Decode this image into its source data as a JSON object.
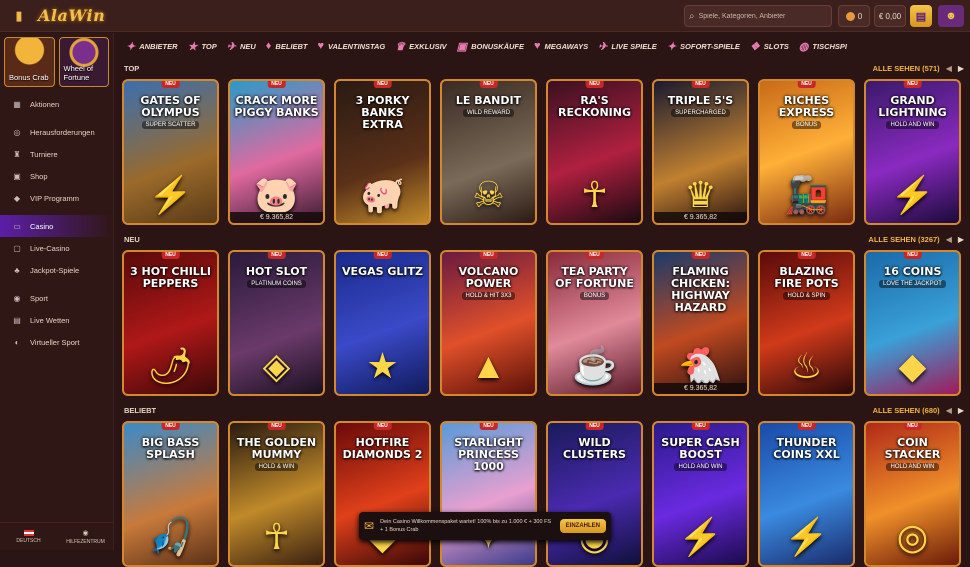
{
  "header": {
    "logo": "AlaWin",
    "search_placeholder": "Spiele, Kategorien, Anbieter",
    "coins": "0",
    "balance": "€ 0,00"
  },
  "sidebar": {
    "promos": [
      {
        "label": "Bonus Crab"
      },
      {
        "label": "Wheel of Fortune"
      }
    ],
    "items": [
      {
        "label": "Aktionen",
        "icon": "▦"
      },
      {
        "label": "Herausforderungen",
        "icon": "◎"
      },
      {
        "label": "Turniere",
        "icon": "♜"
      },
      {
        "label": "Shop",
        "icon": "▣"
      },
      {
        "label": "VIP Programm",
        "icon": "◆"
      },
      {
        "label": "Casino",
        "icon": "▭"
      },
      {
        "label": "Live-Casino",
        "icon": "▢"
      },
      {
        "label": "Jackpot-Spiele",
        "icon": "♣"
      },
      {
        "label": "Sport",
        "icon": "◉"
      },
      {
        "label": "Live Wetten",
        "icon": "▤"
      },
      {
        "label": "Virtueller Sport",
        "icon": "◐"
      }
    ],
    "language": "DEUTSCH",
    "help": "HILFEZENTRUM"
  },
  "categories": [
    {
      "label": "ANBIETER",
      "icon": "✦"
    },
    {
      "label": "TOP",
      "icon": "★"
    },
    {
      "label": "NEU",
      "icon": "✈"
    },
    {
      "label": "BELIEBT",
      "icon": "♦"
    },
    {
      "label": "VALENTINSTAG",
      "icon": "♥"
    },
    {
      "label": "EXKLUSIV",
      "icon": "♛"
    },
    {
      "label": "BONUSKÄUFE",
      "icon": "▣"
    },
    {
      "label": "MEGAWAYS",
      "icon": "♥"
    },
    {
      "label": "LIVE SPIELE",
      "icon": "✈"
    },
    {
      "label": "SOFORT-SPIELE",
      "icon": "✦"
    },
    {
      "label": "SLOTS",
      "icon": "❖"
    },
    {
      "label": "TISCHSPI",
      "icon": "◍"
    }
  ],
  "sections": [
    {
      "title": "TOP",
      "see_all": "ALLE SEHEN (571)",
      "games": [
        {
          "name": "Gates of Olympus",
          "sub": "Super Scatter",
          "bg": "linear-gradient(160deg,#3a6fb0,#9a6a2a 60%,#5a3a18)",
          "art": "⚡",
          "jackpot": ""
        },
        {
          "name": "Crack More Piggy Banks",
          "sub": "",
          "bg": "linear-gradient(160deg,#2a9ac8,#e06aa0 55%,#3a1a30)",
          "art": "🐷",
          "jackpot": "€ 9.365,82"
        },
        {
          "name": "3 Porky Banks Extra",
          "sub": "",
          "bg": "linear-gradient(160deg,#2a1a12,#5a3018 60%,#c08a2a)",
          "art": "🐖",
          "jackpot": ""
        },
        {
          "name": "Le Bandit",
          "sub": "Wild Reward",
          "bg": "linear-gradient(160deg,#3a2a22,#7a6a58 60%,#2a1a14)",
          "art": "☠",
          "jackpot": ""
        },
        {
          "name": "Ra's Reckoning",
          "sub": "",
          "bg": "linear-gradient(160deg,#3a1020,#b02040 55%,#1a0a10)",
          "art": "☥",
          "jackpot": ""
        },
        {
          "name": "Triple 5's",
          "sub": "Supercharged",
          "bg": "linear-gradient(160deg,#1a1a30,#c08030 60%,#2a1410)",
          "art": "♛",
          "jackpot": "€ 9.365,82"
        },
        {
          "name": "Riches Express",
          "sub": "Bonus",
          "bg": "linear-gradient(160deg,#c86a18,#ffb038 50%,#7a2a10)",
          "art": "🚂",
          "jackpot": ""
        },
        {
          "name": "Grand Lightning",
          "sub": "Hold and Win",
          "bg": "linear-gradient(160deg,#3a1a6a,#8a2ac0 55%,#1a0a3a)",
          "art": "⚡",
          "jackpot": ""
        }
      ]
    },
    {
      "title": "NEU",
      "see_all": "ALLE SEHEN (3267)",
      "games": [
        {
          "name": "3 Hot Chilli Peppers",
          "sub": "",
          "bg": "linear-gradient(160deg,#5a0a0a,#b01818 55%,#3a0808)",
          "art": "🌶",
          "jackpot": ""
        },
        {
          "name": "Hot Slot",
          "sub": "Platinum Coins",
          "bg": "linear-gradient(160deg,#2a1a3a,#6a3a6a 60%,#1a1020)",
          "art": "◈",
          "jackpot": ""
        },
        {
          "name": "Vegas Glitz",
          "sub": "",
          "bg": "linear-gradient(160deg,#1a2a8a,#3a4ac8 55%,#101a5a)",
          "art": "★",
          "jackpot": ""
        },
        {
          "name": "Volcano Power",
          "sub": "Hold & Hit 3x3",
          "bg": "linear-gradient(160deg,#6a1a40,#e0502a 55%,#5a1008)",
          "art": "▲",
          "jackpot": ""
        },
        {
          "name": "Tea Party of Fortune",
          "sub": "Bonus",
          "bg": "linear-gradient(160deg,#8a2a3a,#e08a9a 55%,#5a1a2a)",
          "art": "☕",
          "jackpot": ""
        },
        {
          "name": "Flaming Chicken: Highway Hazard",
          "sub": "",
          "bg": "linear-gradient(160deg,#1a3a6a,#c04a20 55%,#2a1010)",
          "art": "🐔",
          "jackpot": "€ 9.365,82"
        },
        {
          "name": "Blazing Fire Pots",
          "sub": "Hold & Spin",
          "bg": "linear-gradient(160deg,#5a0a0a,#d03a1a 55%,#2a0808)",
          "art": "♨",
          "jackpot": ""
        },
        {
          "name": "16 Coins",
          "sub": "Love the Jackpot",
          "bg": "linear-gradient(160deg,#1a6aa8,#3aa0d8 55%,#a01a5a)",
          "art": "◆",
          "jackpot": ""
        }
      ]
    },
    {
      "title": "BELIEBT",
      "see_all": "ALLE SEHEN (680)",
      "games": [
        {
          "name": "Big Bass Splash",
          "sub": "",
          "bg": "linear-gradient(160deg,#3a8ac8,#c87a3a 60%,#5a3018)",
          "art": "🎣",
          "jackpot": ""
        },
        {
          "name": "The Golden Mummy",
          "sub": "Hold & Win",
          "bg": "linear-gradient(160deg,#2a1a10,#c08a2a 55%,#3a2010)",
          "art": "☥",
          "jackpot": ""
        },
        {
          "name": "Hotfire Diamonds 2",
          "sub": "",
          "bg": "linear-gradient(160deg,#6a0a0a,#e0401a 55%,#3a0808)",
          "art": "◆",
          "jackpot": ""
        },
        {
          "name": "Starlight Princess 1000",
          "sub": "",
          "bg": "linear-gradient(160deg,#5a9ad8,#e8a0d0 55%,#3a3a8a)",
          "art": "✦",
          "jackpot": ""
        },
        {
          "name": "Wild Clusters",
          "sub": "",
          "bg": "linear-gradient(160deg,#1a1a5a,#4a2ab0 55%,#10103a)",
          "art": "◉",
          "jackpot": ""
        },
        {
          "name": "Super Cash Boost",
          "sub": "Hold and Win",
          "bg": "linear-gradient(160deg,#2a1a8a,#6a2ae0 55%,#1a0a4a)",
          "art": "⚡",
          "jackpot": ""
        },
        {
          "name": "Thunder Coins XXL",
          "sub": "",
          "bg": "linear-gradient(160deg,#1a4aa8,#3a8ae0 55%,#1a2a6a)",
          "art": "⚡",
          "jackpot": ""
        },
        {
          "name": "Coin Stacker",
          "sub": "Hold and Win",
          "bg": "linear-gradient(160deg,#b02a18,#f0902a 55%,#6a1a08)",
          "art": "◎",
          "jackpot": ""
        }
      ]
    }
  ],
  "badge": "NEU",
  "toast": {
    "text": "Dein Casino Willkommenspaket wartet! 100% bis zu 1.000 € + 300 FS + 1 Bonus Crab",
    "button": "EINZAHLEN"
  },
  "colors": {
    "accent": "#f3b43e",
    "active_nav": "#5c1ea8",
    "tile_border": "#d3882c"
  }
}
